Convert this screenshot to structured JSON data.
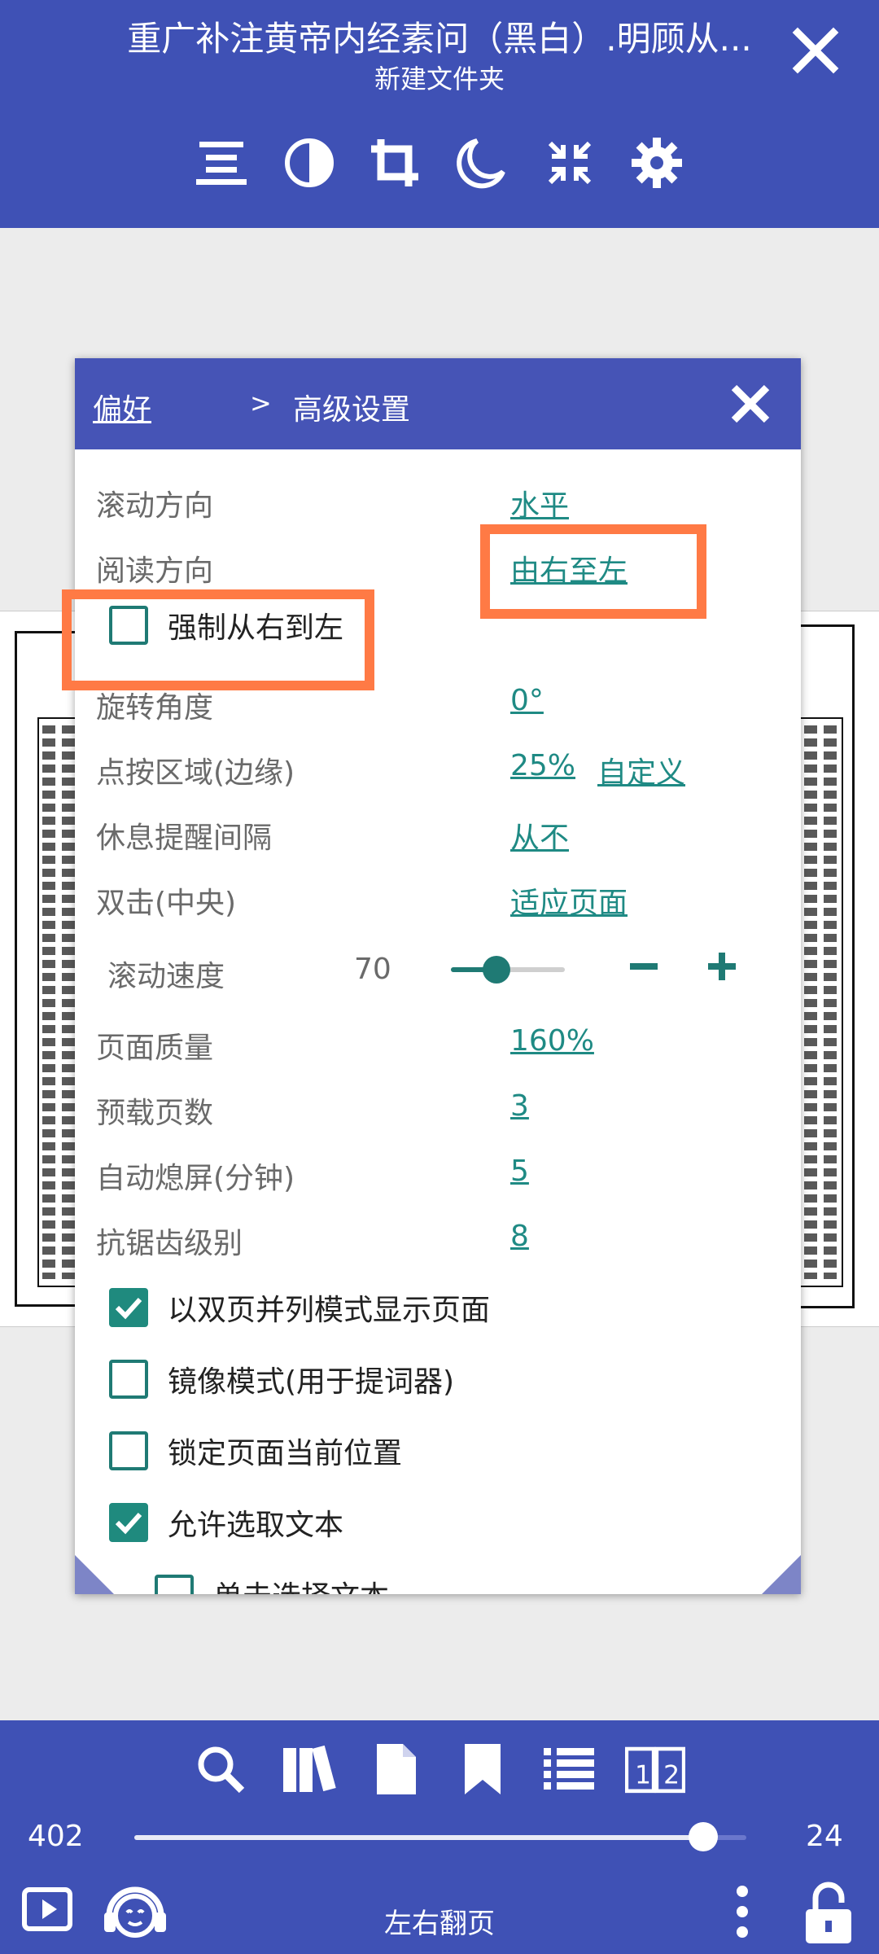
{
  "header": {
    "title": "重广补注黄帝内经素问（黑白）.明顾从...",
    "subtitle": "新建文件夹",
    "close_icon": "close-icon",
    "icons": [
      "menu-lines-icon",
      "contrast-icon",
      "crop-icon",
      "night-mode-icon",
      "collapse-icon",
      "settings-gear-icon"
    ]
  },
  "dialog": {
    "breadcrumb_root": "偏好",
    "breadcrumb_sep": ">",
    "breadcrumb_current": "高级设置",
    "settings": [
      {
        "label": "滚动方向",
        "value": "水平"
      },
      {
        "label": "阅读方向",
        "value": "由右至左"
      },
      {
        "label": "旋转角度",
        "value": "0°"
      },
      {
        "label": "点按区域(边缘)",
        "value": "25%",
        "value2": "自定义"
      },
      {
        "label": "休息提醒间隔",
        "value": "从不"
      },
      {
        "label": "双击(中央)",
        "value": "适应页面"
      },
      {
        "label": "页面质量",
        "value": "160%"
      },
      {
        "label": "预载页数",
        "value": "3"
      },
      {
        "label": "自动熄屏(分钟)",
        "value": "5"
      },
      {
        "label": "抗锯齿级别",
        "value": "8"
      }
    ],
    "force_rtl": {
      "label": "强制从右到左",
      "checked": false
    },
    "scroll_speed": {
      "label": "滚动速度",
      "value": "70",
      "minus": "−",
      "plus": "+"
    },
    "checkboxes": [
      {
        "label": "以双页并列模式显示页面",
        "checked": true
      },
      {
        "label": "镜像模式(用于提词器)",
        "checked": false
      },
      {
        "label": "锁定页面当前位置",
        "checked": false
      },
      {
        "label": "允许选取文本",
        "checked": true
      },
      {
        "label": "单击选择文本",
        "checked": false
      }
    ]
  },
  "bottom": {
    "icons": [
      "search-icon",
      "library-icon",
      "document-icon",
      "bookmark-icon",
      "toc-list-icon",
      "two-page-icon"
    ],
    "page_current": "402",
    "page_total": "24",
    "progress_fraction": 0.93,
    "mode_label": "左右翻页",
    "left_icons": [
      "play-icon",
      "tts-headphones-icon"
    ],
    "right_icons": [
      "more-vert-icon",
      "lock-icon"
    ]
  },
  "colors": {
    "primary": "#3f51b5",
    "dialog_header": "#4654b6",
    "teal": "#1f8a84",
    "highlight": "#ff7a45"
  }
}
